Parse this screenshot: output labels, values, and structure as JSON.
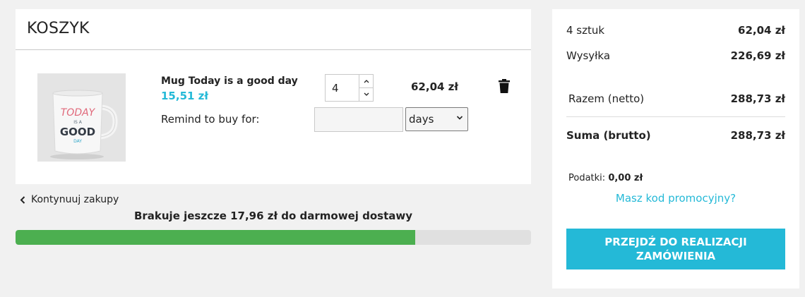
{
  "cart": {
    "title": "KOSZYK",
    "item": {
      "name": "Mug Today is a good day",
      "unit_price": "15,51 zł",
      "quantity": "4",
      "line_total": "62,04 zł",
      "image_text": {
        "line1": "TODAY",
        "line2": "IS A",
        "line3": "GOOD",
        "line4": "DAY"
      }
    },
    "remind": {
      "label": "Remind to buy for:",
      "value": "",
      "unit": "days"
    },
    "continue_label": "Kontynuuj zakupy",
    "free_shipping_text": "Brakuje jeszcze 17,96 zł do darmowej dostawy",
    "free_shipping_progress": 0.775
  },
  "summary": {
    "items_label": "4 sztuk",
    "items_value": "62,04 zł",
    "shipping_label": "Wysyłka",
    "shipping_value": "226,69 zł",
    "net_label": "Razem (netto)",
    "net_value": "288,73 zł",
    "gross_label": "Suma (brutto)",
    "gross_value": "288,73 zł",
    "taxes_label": "Podatki:",
    "taxes_value": "0,00 zł",
    "promo_link": "Masz kod promocyjny?",
    "checkout_label": "PRZEJDŹ DO REALIZACJI ZAMÓWIENIA"
  },
  "colors": {
    "accent": "#24b9d7",
    "progress": "#4caf50",
    "background": "#f1f1f1"
  },
  "icons": {
    "trash": "trash-icon",
    "spin_up": "chevron-up-icon",
    "spin_down": "chevron-down-icon",
    "back": "chevron-left-icon",
    "select": "chevron-down-icon"
  }
}
